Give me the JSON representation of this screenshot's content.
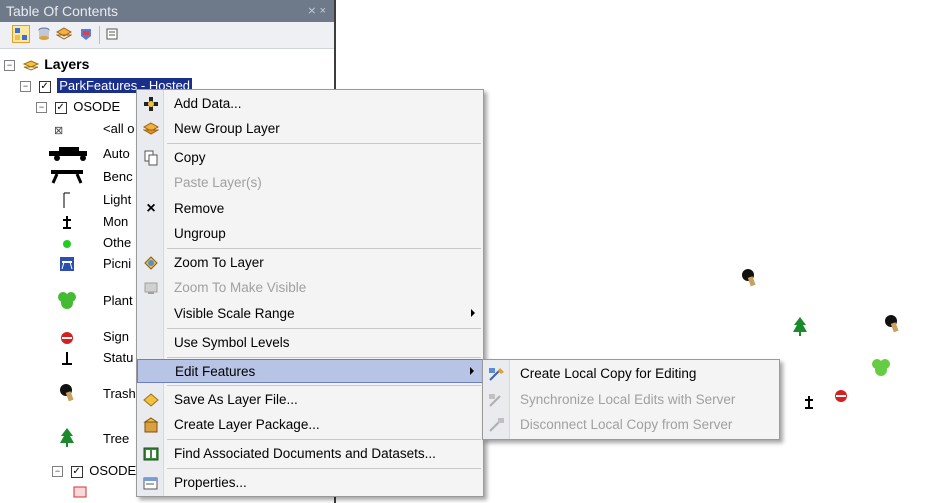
{
  "toc": {
    "title": "Table Of Contents",
    "title_buttons": "⨯ ×",
    "root_label": "Layers",
    "service_label": "ParkFeatures - Hosted",
    "group1_label": "OSODE",
    "all_label": "<all o",
    "classes": [
      "Auto",
      "Benc",
      "Light",
      "Mon",
      "Othe",
      "Picni",
      "Plant",
      "Sign",
      "Statu",
      "Trash",
      "Tree"
    ],
    "group2_label": "OSODE"
  },
  "menu": {
    "items": [
      {
        "label": "Add Data...",
        "icon": "add-data-icon"
      },
      {
        "label": "New Group Layer",
        "icon": "group-layer-icon"
      },
      {
        "label": "Copy",
        "icon": "copy-icon"
      },
      {
        "label": "Paste Layer(s)",
        "icon": "paste-icon"
      },
      {
        "label": "Remove",
        "icon": "remove-icon"
      },
      {
        "label": "Ungroup",
        "icon": ""
      },
      {
        "label": "Zoom To Layer",
        "icon": "zoom-to-layer-icon"
      },
      {
        "label": "Zoom To Make Visible",
        "icon": "zoom-visible-icon"
      },
      {
        "label": "Visible Scale Range",
        "icon": ""
      },
      {
        "label": "Use Symbol Levels",
        "icon": ""
      },
      {
        "label": "Edit Features",
        "icon": ""
      },
      {
        "label": "Save As Layer File...",
        "icon": "layer-file-icon"
      },
      {
        "label": "Create Layer Package...",
        "icon": "layer-package-icon"
      },
      {
        "label": "Find Associated Documents and Datasets...",
        "icon": "find-documents-icon"
      },
      {
        "label": "Properties...",
        "icon": "properties-icon"
      }
    ],
    "remove_glyph": "×"
  },
  "submenu": {
    "items": [
      {
        "label": "Create Local Copy for Editing",
        "icon": "create-local-copy-icon"
      },
      {
        "label": "Synchronize Local Edits with Server",
        "icon": "sync-icon"
      },
      {
        "label": "Disconnect Local Copy from Server",
        "icon": "disconnect-icon"
      }
    ]
  },
  "colors": {
    "highlight": "#b8c4e6",
    "selection": "#1a2f8c",
    "tree_green": "#1a8a2a",
    "sign_red": "#d42020"
  }
}
